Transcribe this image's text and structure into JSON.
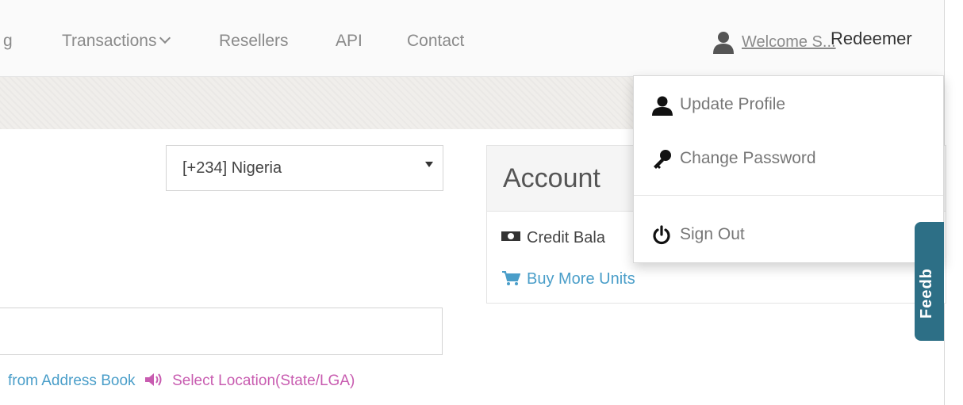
{
  "nav": {
    "partial_item": "g",
    "items": [
      "Transactions",
      "Resellers",
      "API",
      "Contact"
    ],
    "welcome_text": "Welcome S...",
    "user_name": "Redeemer"
  },
  "form": {
    "country_value": "[+234] Nigeria",
    "message_value": "",
    "address_book_link": "from Address Book",
    "location_link": "Select Location(State/LGA)"
  },
  "account": {
    "title": "Account",
    "credit_label": "Credit Bala",
    "buy_link": "Buy More Units"
  },
  "user_dropdown": {
    "update_profile": "Update Profile",
    "change_password": "Change Password",
    "sign_out": "Sign Out"
  },
  "feedback": {
    "label": "Feedb"
  },
  "colors": {
    "link_blue": "#4a9ec9",
    "link_pink": "#c85cb0",
    "feedback_tab": "#2d6f86"
  },
  "icons": [
    "user-icon",
    "chevron-down-icon",
    "select-caret-icon",
    "money-icon",
    "cart-icon",
    "speaker-icon",
    "key-icon",
    "power-icon"
  ]
}
